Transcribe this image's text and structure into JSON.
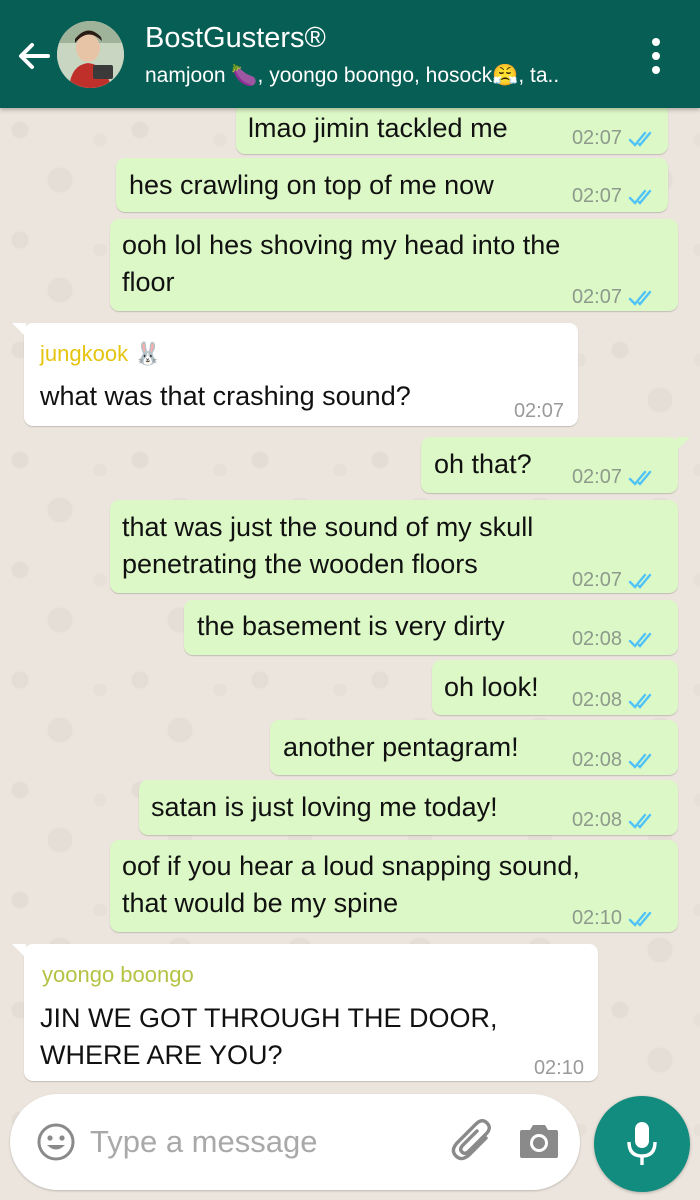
{
  "header": {
    "title": "BostGusters®",
    "subtitle": "namjoon 🍆, yoongo boongo, hosock😤, ta..",
    "back_icon": "arrow-left-icon",
    "menu_icon": "vertical-dots-icon"
  },
  "messages": [
    {
      "direction": "out",
      "text_lines": [
        "lmao jimin tackled me"
      ],
      "time": "02:07",
      "status": "read"
    },
    {
      "direction": "out",
      "text_lines": [
        "hes crawling on top of me now"
      ],
      "time": "02:07",
      "status": "read"
    },
    {
      "direction": "out",
      "text_lines": [
        "ooh lol hes shoving my head into the",
        "floor"
      ],
      "time": "02:07",
      "status": "read"
    },
    {
      "direction": "in",
      "sender": "jungkook 🐰",
      "sender_color": "#e5c40f",
      "text_lines": [
        "what was that crashing sound?"
      ],
      "time": "02:07"
    },
    {
      "direction": "out",
      "text_lines": [
        "oh that?"
      ],
      "time": "02:07",
      "status": "read"
    },
    {
      "direction": "out",
      "text_lines": [
        "that was just the sound of my skull",
        "penetrating the wooden floors"
      ],
      "time": "02:07",
      "status": "read"
    },
    {
      "direction": "out",
      "text_lines": [
        "the basement is very dirty"
      ],
      "time": "02:08",
      "status": "read"
    },
    {
      "direction": "out",
      "text_lines": [
        "oh look!"
      ],
      "time": "02:08",
      "status": "read"
    },
    {
      "direction": "out",
      "text_lines": [
        "another pentagram!"
      ],
      "time": "02:08",
      "status": "read"
    },
    {
      "direction": "out",
      "text_lines": [
        "satan is just loving me today!"
      ],
      "time": "02:08",
      "status": "read"
    },
    {
      "direction": "out",
      "text_lines": [
        "oof if you hear a loud snapping sound,",
        "that would be my spine"
      ],
      "time": "02:10",
      "status": "read"
    },
    {
      "direction": "in",
      "sender": "yoongo boongo",
      "sender_color": "#b5c244",
      "text_lines": [
        "JIN WE GOT THROUGH THE DOOR,",
        "WHERE ARE YOU?"
      ],
      "time": "02:10"
    }
  ],
  "composer": {
    "placeholder": "Type a message",
    "emoji_icon": "smiley-icon",
    "attach_icon": "paperclip-icon",
    "camera_icon": "camera-icon",
    "mic_icon": "microphone-icon"
  },
  "colors": {
    "header": "#075e54",
    "outgoing_bubble": "#dcf8c6",
    "incoming_bubble": "#ffffff",
    "read_tick": "#4fc3f7",
    "mic_button": "#128c7e"
  }
}
